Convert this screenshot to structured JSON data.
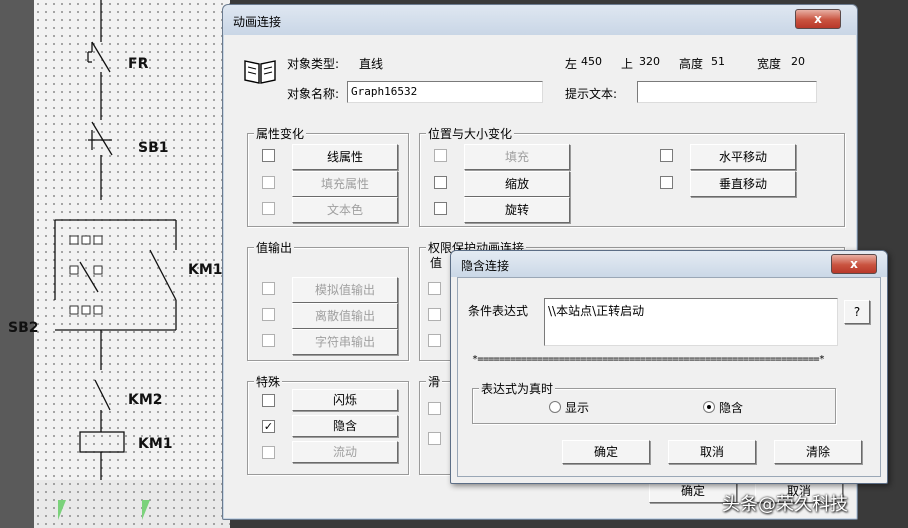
{
  "ladder": {
    "labels": {
      "fr": "FR",
      "sb1": "SB1",
      "km1_contact": "KM1",
      "sb2": "SB2",
      "km2": "KM2",
      "km1_coil": "KM1"
    }
  },
  "dialog": {
    "title": "动画连接",
    "close_glyph": "x",
    "object_type_label": "对象类型:",
    "object_type_value": "直线",
    "object_name_label": "对象名称:",
    "object_name_value": "Graph16532",
    "left_label": "左",
    "left_value": "450",
    "top_label": "上",
    "top_value": "320",
    "height_label": "高度",
    "height_value": "51",
    "width_label": "宽度",
    "width_value": "20",
    "hint_label": "提示文本:",
    "hint_value": "",
    "groups": {
      "property": {
        "title": "属性变化",
        "items": [
          {
            "label": "线属性",
            "checked": false,
            "enabled": true
          },
          {
            "label": "填充属性",
            "checked": false,
            "enabled": false
          },
          {
            "label": "文本色",
            "checked": false,
            "enabled": false
          }
        ]
      },
      "position": {
        "title": "位置与大小变化",
        "left_items": [
          {
            "label": "填充",
            "enabled": false
          },
          {
            "label": "缩放",
            "enabled": true
          },
          {
            "label": "旋转",
            "enabled": true
          }
        ],
        "right_items": [
          {
            "label": "水平移动",
            "enabled": true
          },
          {
            "label": "垂直移动",
            "enabled": true
          }
        ]
      },
      "value_output": {
        "title": "值输出",
        "items": [
          {
            "label": "模拟值输出",
            "enabled": false
          },
          {
            "label": "离散值输出",
            "enabled": false
          },
          {
            "label": "字符串输出",
            "enabled": false
          }
        ]
      },
      "security": {
        "title": "权限保护动画连接",
        "inner_title": "值"
      },
      "special": {
        "title": "特殊",
        "items": [
          {
            "label": "闪烁",
            "checked": false,
            "enabled": true
          },
          {
            "label": "隐含",
            "checked": true,
            "enabled": true
          },
          {
            "label": "流动",
            "checked": false,
            "enabled": false
          }
        ]
      },
      "slider": {
        "title": "滑"
      }
    },
    "ok_label": "确定",
    "cancel_label": "取消"
  },
  "subdialog": {
    "title": "隐含连接",
    "close_glyph": "x",
    "condition_label": "条件表达式",
    "condition_value": "\\\\本站点\\正转启动",
    "browse_label": "?",
    "separator": "*===============================================================*",
    "true_group_title": "表达式为真时",
    "show_label": "显示",
    "hide_label": "隐含",
    "selected": "hide",
    "ok_label": "确定",
    "cancel_label": "取消",
    "clear_label": "清除"
  },
  "watermark": "头条@荣久科技",
  "check_mark": "✓"
}
